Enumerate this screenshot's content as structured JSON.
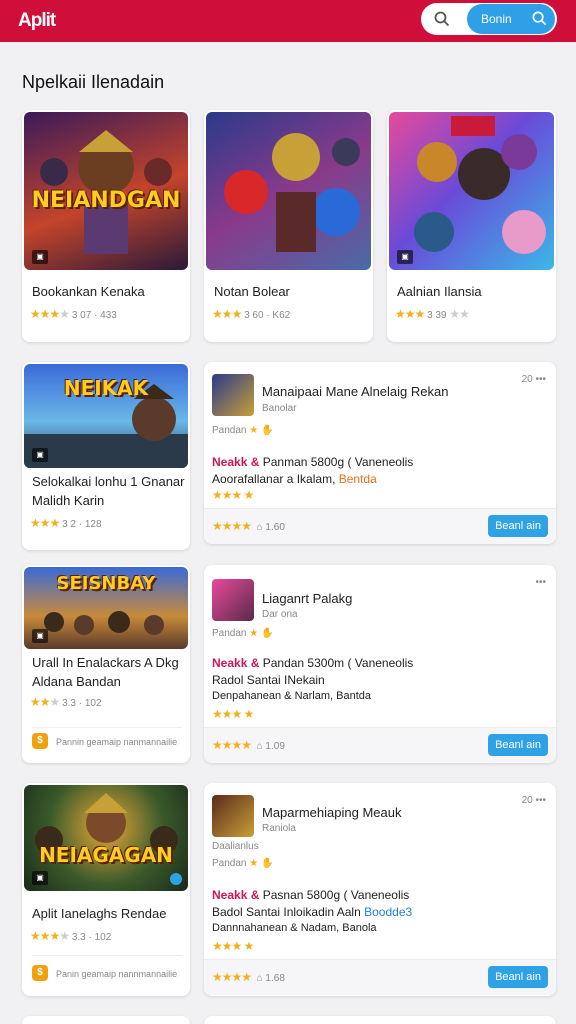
{
  "header": {
    "logo": "Aplit",
    "search_label": "Bonin"
  },
  "section_title": "Npelkaii Ilenadain",
  "top_row": [
    {
      "thumb_title": "NEIANDGAN",
      "name": "Bookankan Kenaka",
      "rating": "3 07 · 433"
    },
    {
      "thumb_title": "",
      "name": "Notan Bolear",
      "rating": "3 60 · K62"
    },
    {
      "thumb_title": "",
      "name": "Aalnian Ilansia",
      "rating": "3 39"
    }
  ],
  "row2": {
    "left": {
      "thumb_title": "NEIKAK",
      "name_line1": "Selokalkai lonhu 1 Gnanar",
      "name_line2": "Malidh Karin",
      "rating": "3 2 · 128"
    },
    "right": {
      "title": "Manaipaai Mane Alnelaig Rekan",
      "subtitle": "Banolar",
      "meta": "Pandan",
      "line1_a": "Neakk &",
      "line1_b": "Panman 5800g ( Vaneneolis",
      "line2_a": "Aoorafallanar a Ikalam,",
      "line2_b": "Bentda",
      "count": "20",
      "footer_value": "1.60",
      "button": "Beanl ain"
    }
  },
  "row3": {
    "left": {
      "thumb_title": "SEISNBAY",
      "name_line1": "Urall In Enalackars A Dkg",
      "name_line2": "Aldana Bandan",
      "rating": "3.3 · 102",
      "footer_text": "Pannin geamaip nanmannailie"
    },
    "right": {
      "title": "Liaganrt Palakg",
      "subtitle": "Dar ona",
      "meta": "Pandan",
      "line1_a": "Neakk &",
      "line1_b": "Pandan 5300m ( Vaneneolis",
      "line2": "Radol Santai INekain",
      "line3": "Denpahanean & Narlam, Bantda",
      "footer_value": "1.09",
      "button": "Beanl ain"
    }
  },
  "row4": {
    "left": {
      "thumb_title": "NEIAGAGAN",
      "name": "Aplit Ianelaghs Rendae",
      "rating": "3.3 · 102",
      "footer_text": "Panin geamaip nannmannailie"
    },
    "right": {
      "title": "Maparmehiaping Meauk",
      "subtitle": "Raniola",
      "meta_top": "Daalianlus",
      "meta": "Pandan",
      "line1_a": "Neakk &",
      "line1_b": "Pasnan 5800g ( Vaneneolis",
      "line2_a": "Badol Santai Inloikadin Aaln",
      "line2_b": "Boodde3",
      "line3": "Dannnahanean & Nadam, Banola",
      "count": "20",
      "footer_value": "1.68",
      "button": "Beanl ain"
    }
  },
  "colors": {
    "brand": "#cf0f3a",
    "accent": "#2ea2e4",
    "star": "#f2b01e",
    "highlight": "#d0145a"
  }
}
